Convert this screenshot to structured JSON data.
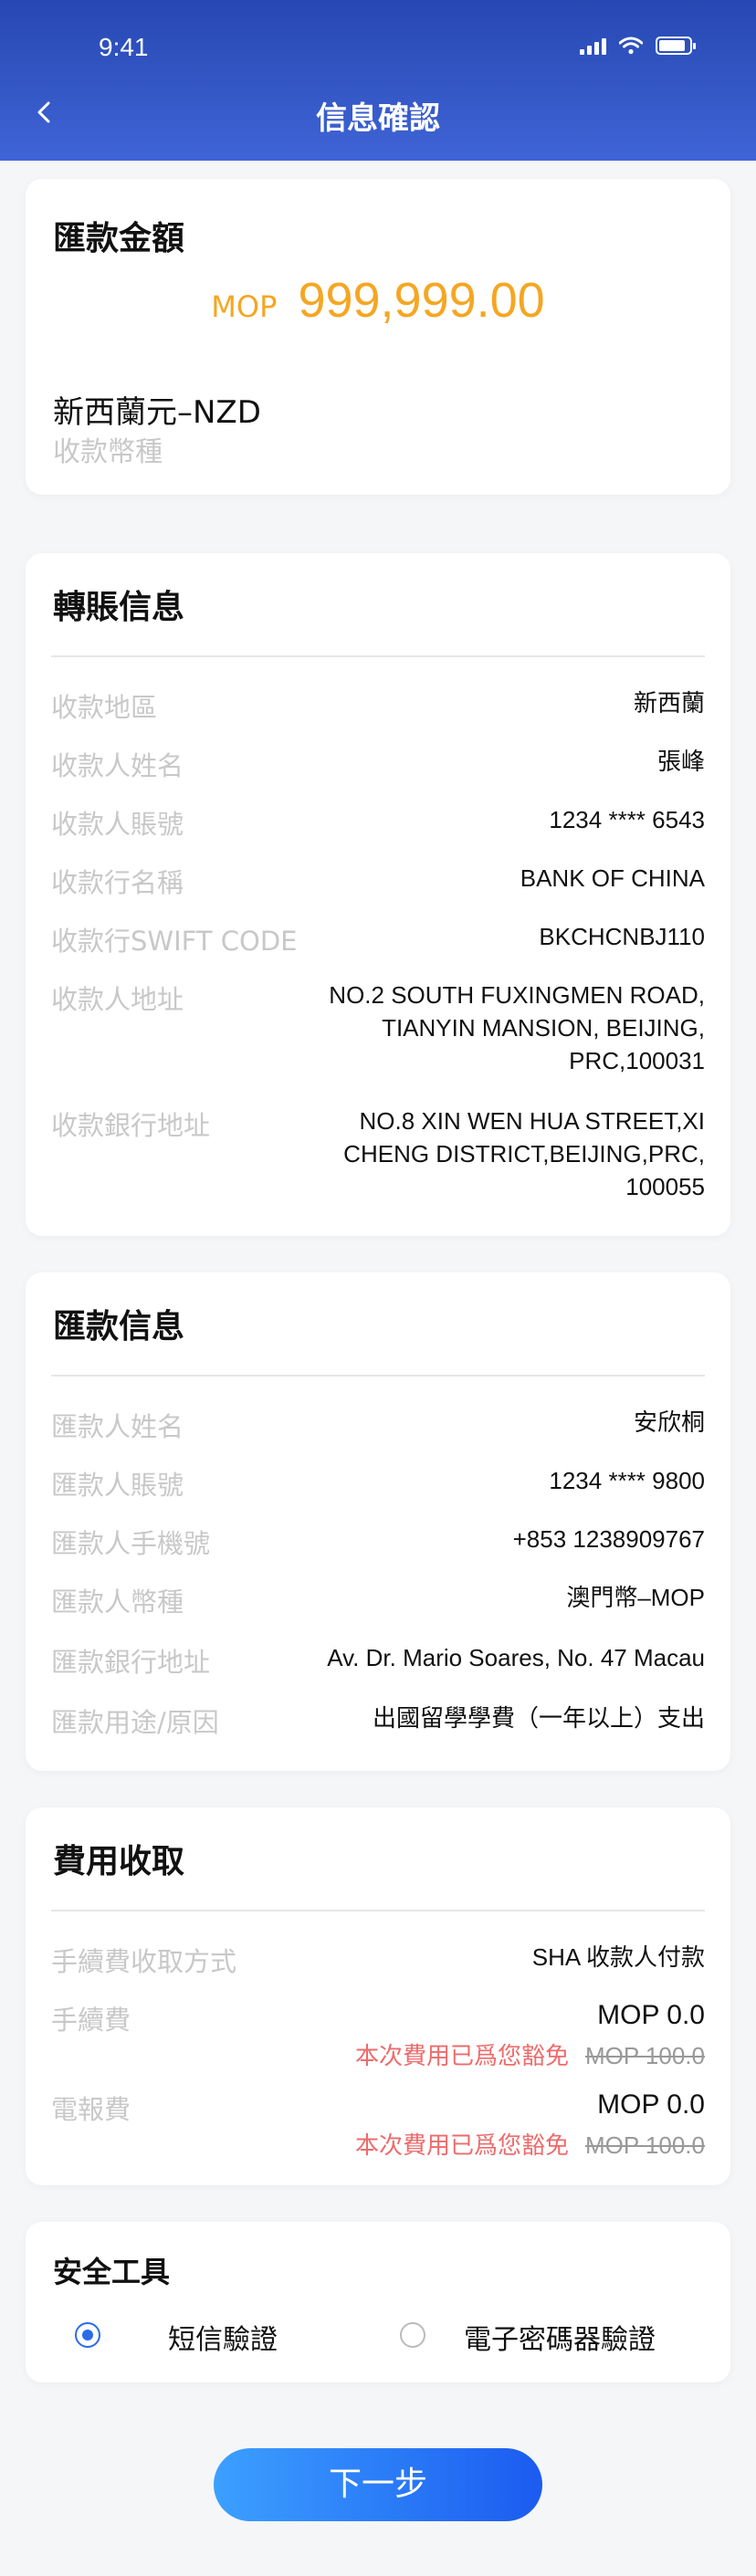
{
  "status_bar": {
    "time": "9:41"
  },
  "header": {
    "title": "信息確認"
  },
  "amount_card": {
    "title": "匯款金額",
    "currency": "MOP",
    "amount": "999,999.00",
    "currency_name": "新西蘭元–NZD",
    "currency_label": "收款幣種"
  },
  "transfer_info": {
    "title": "轉賬信息",
    "rows": [
      {
        "label": "收款地區",
        "value": "新西蘭"
      },
      {
        "label": "收款人姓名",
        "value": "張峰"
      },
      {
        "label": "收款人賬號",
        "value": "1234 **** 6543"
      },
      {
        "label": "收款行名稱",
        "value": "BANK OF CHINA"
      },
      {
        "label": "收款行SWIFT CODE",
        "value": "BKCHCNBJ110"
      },
      {
        "label": "收款人地址",
        "value": [
          "NO.2 SOUTH FUXINGMEN ROAD,",
          "TIANYIN MANSION, BEIJING,",
          "PRC,100031"
        ]
      },
      {
        "label": "收款銀行地址",
        "value": [
          "NO.8 XIN WEN HUA STREET,XI",
          "CHENG DISTRICT,BEIJING,PRC,",
          "100055"
        ]
      }
    ]
  },
  "remitter_info": {
    "title": "匯款信息",
    "rows": [
      {
        "label": "匯款人姓名",
        "value": "安欣桐"
      },
      {
        "label": "匯款人賬號",
        "value": "1234 **** 9800"
      },
      {
        "label": "匯款人手機號",
        "value": "+853 1238909767"
      },
      {
        "label": "匯款人幣種",
        "value": "澳門幣–MOP"
      },
      {
        "label": "匯款銀行地址",
        "value": "Av. Dr. Mario Soares, No. 47 Macau"
      },
      {
        "label": "匯款用途/原因",
        "value": "出國留學學費（一年以上）支出"
      }
    ]
  },
  "fees": {
    "title": "費用收取",
    "method_label": "手續費收取方式",
    "method_value": "SHA 收款人付款",
    "handling_label": "手續費",
    "handling_value": "MOP 0.0",
    "handling_note": "本次費用已爲您豁免",
    "handling_original": "MOP 100.0",
    "telegraph_label": "電報費",
    "telegraph_value": "MOP 0.0",
    "telegraph_note": "本次費用已爲您豁免",
    "telegraph_original": "MOP 100.0"
  },
  "security": {
    "title": "安全工具",
    "options": [
      {
        "label": "短信驗證",
        "selected": true
      },
      {
        "label": "電子密碼器驗證",
        "selected": false
      }
    ]
  },
  "next_button": "下一步",
  "colors": {
    "header": "#2f52c4",
    "accent_amount": "#f5a623",
    "free_note": "#ee6b6b",
    "button": "#1b5bf0"
  }
}
